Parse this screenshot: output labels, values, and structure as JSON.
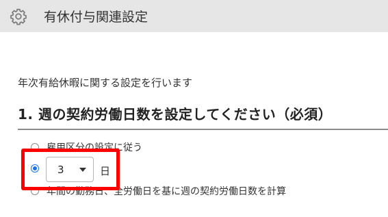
{
  "header": {
    "title": "有休付与関連設定",
    "icon": "gear-icon"
  },
  "description": "年次有給休暇に関する設定を行います",
  "section": {
    "title": "1. 週の契約労働日数を設定してください（必須）",
    "options": [
      {
        "label": "雇用区分の設定に従う",
        "selected": false
      },
      {
        "select_value": "3",
        "unit_label": "日",
        "selected": true
      },
      {
        "label": "年間の勤務日、全労働日を基に週の契約労働日数を計算",
        "selected": false
      }
    ]
  },
  "colors": {
    "header_bg": "#e6e6e6",
    "accent": "#1a73e8",
    "highlight": "#ff0000"
  }
}
